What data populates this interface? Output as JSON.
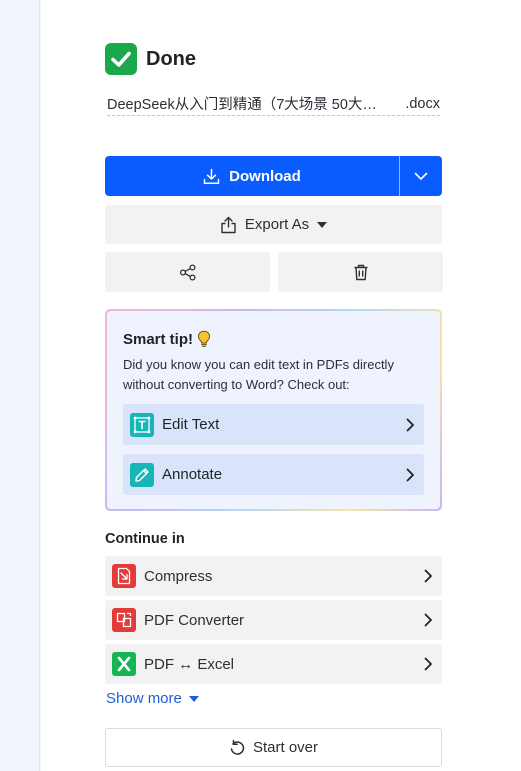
{
  "status": {
    "title": "Done",
    "icon": "check-icon"
  },
  "file": {
    "name_base": "DeepSeek从入门到精通（7大场景 50大…",
    "extension": ".docx"
  },
  "actions": {
    "download_label": "Download",
    "export_label": "Export As",
    "share_icon": "share-icon",
    "delete_icon": "trash-icon"
  },
  "smart_tip": {
    "title": "Smart tip!",
    "text": "Did you know you can edit text in PDFs directly without converting to Word? Check out:",
    "items": [
      {
        "label": "Edit Text",
        "icon": "edit-text-icon"
      },
      {
        "label": "Annotate",
        "icon": "pen-icon"
      }
    ]
  },
  "continue_in": {
    "title": "Continue in",
    "items": [
      {
        "label": "Compress",
        "icon": "compress-icon",
        "color": "#e33b3b"
      },
      {
        "label": "PDF Converter",
        "icon": "converter-icon",
        "color": "#e33b3b"
      },
      {
        "label": "PDF ↔ Excel",
        "icon": "excel-icon",
        "color": "#17b455"
      }
    ]
  },
  "show_more_label": "Show more",
  "start_over_label": "Start over",
  "colors": {
    "primary": "#0a5cff",
    "success": "#1aa84b",
    "link": "#1f5fd6"
  }
}
